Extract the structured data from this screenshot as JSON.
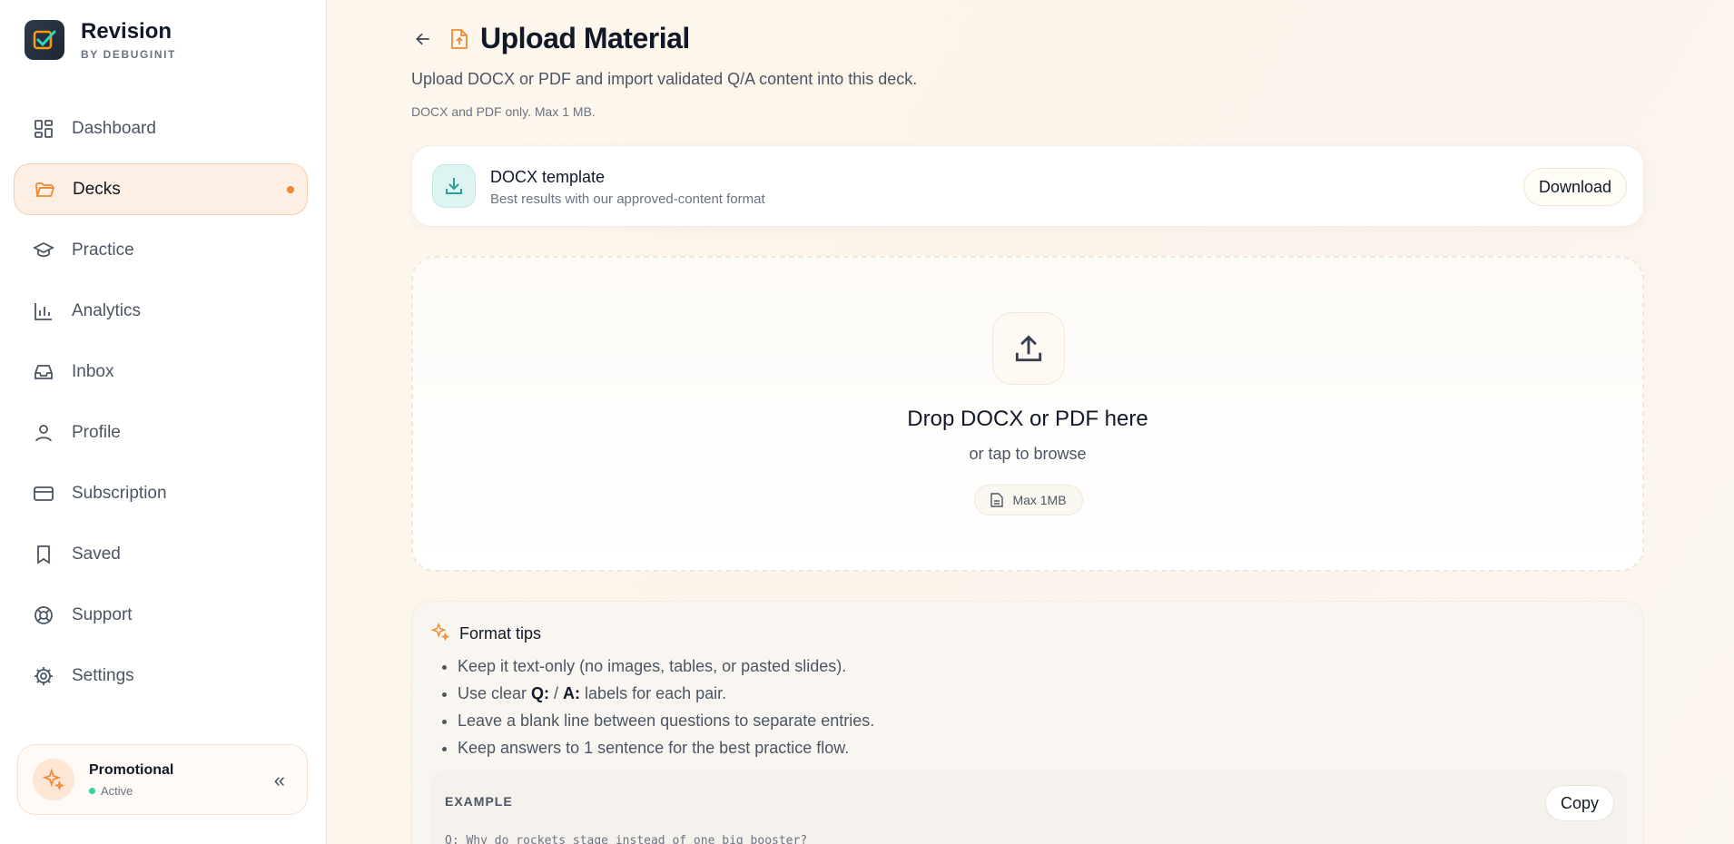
{
  "brand": {
    "title": "Revision",
    "subtitle": "BY DEBUGINIT"
  },
  "sidebar": {
    "items": [
      {
        "label": "Dashboard",
        "icon": "dashboard-icon"
      },
      {
        "label": "Decks",
        "icon": "folder-icon",
        "active": true
      },
      {
        "label": "Practice",
        "icon": "graduation-cap-icon"
      },
      {
        "label": "Analytics",
        "icon": "bar-chart-icon"
      },
      {
        "label": "Inbox",
        "icon": "inbox-icon"
      },
      {
        "label": "Profile",
        "icon": "user-icon"
      },
      {
        "label": "Subscription",
        "icon": "credit-card-icon"
      },
      {
        "label": "Saved",
        "icon": "bookmark-icon"
      },
      {
        "label": "Support",
        "icon": "life-buoy-icon"
      },
      {
        "label": "Settings",
        "icon": "gear-icon"
      }
    ],
    "promo": {
      "title": "Promotional",
      "status": "Active",
      "collapse": "«"
    }
  },
  "page": {
    "title": "Upload Material",
    "subtitle": "Upload DOCX or PDF and import validated Q/A content into this deck.",
    "note": "DOCX and PDF only. Max 1 MB."
  },
  "template": {
    "title": "DOCX template",
    "description": "Best results with our approved-content format",
    "download_label": "Download"
  },
  "dropzone": {
    "title": "Drop DOCX or PDF here",
    "subtitle": "or tap to browse",
    "badge": "Max 1MB"
  },
  "tips": {
    "title": "Format tips",
    "item1": "Keep it text-only (no images, tables, or pasted slides).",
    "item2_prefix": "Use clear ",
    "item2_q": "Q:",
    "item2_sep": " / ",
    "item2_a": "A:",
    "item2_suffix": " labels for each pair.",
    "item3": "Leave a blank line between questions to separate entries.",
    "item4": "Keep answers to 1 sentence for the best practice flow."
  },
  "example": {
    "label": "EXAMPLE",
    "copy_label": "Copy",
    "code": "Q: Why do rockets stage instead of one big booster?"
  },
  "colors": {
    "accent": "#f08a32",
    "teal": "#2aa198",
    "active_bg": "#fdefe3"
  }
}
